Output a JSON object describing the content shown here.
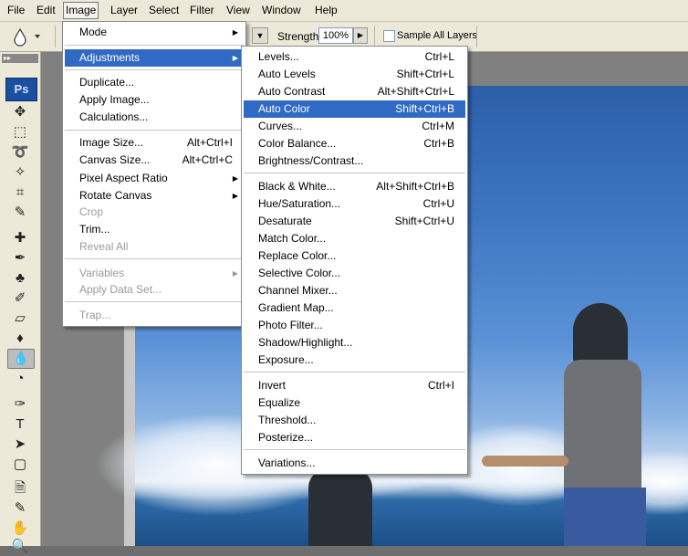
{
  "menubar": {
    "items": [
      "File",
      "Edit",
      "Image",
      "Layer",
      "Select",
      "Filter",
      "View",
      "Window",
      "Help"
    ],
    "active": "Image"
  },
  "options_bar": {
    "strength_label": "Strength:",
    "strength_value": "100%",
    "sample_all_layers_label": "Sample All Layers",
    "sample_all_layers_checked": false
  },
  "toolbox": {
    "logo": "Ps",
    "selected_tool": "blur-tool"
  },
  "image_menu": [
    {
      "label": "Mode",
      "submenu": true,
      "enabled": true
    },
    {
      "separator": true
    },
    {
      "label": "Adjustments",
      "submenu": true,
      "enabled": true,
      "highlighted": true
    },
    {
      "separator": true
    },
    {
      "label": "Duplicate...",
      "enabled": true
    },
    {
      "label": "Apply Image...",
      "enabled": true
    },
    {
      "label": "Calculations...",
      "enabled": true
    },
    {
      "separator": true
    },
    {
      "label": "Image Size...",
      "shortcut": "Alt+Ctrl+I",
      "enabled": true
    },
    {
      "label": "Canvas Size...",
      "shortcut": "Alt+Ctrl+C",
      "enabled": true
    },
    {
      "label": "Pixel Aspect Ratio",
      "submenu": true,
      "enabled": true
    },
    {
      "label": "Rotate Canvas",
      "submenu": true,
      "enabled": true
    },
    {
      "label": "Crop",
      "enabled": false
    },
    {
      "label": "Trim...",
      "enabled": true
    },
    {
      "label": "Reveal All",
      "enabled": false
    },
    {
      "separator": true
    },
    {
      "label": "Variables",
      "submenu": true,
      "enabled": false
    },
    {
      "label": "Apply Data Set...",
      "enabled": false
    },
    {
      "separator": true
    },
    {
      "label": "Trap...",
      "enabled": false
    }
  ],
  "adjustments_menu": [
    {
      "label": "Levels...",
      "shortcut": "Ctrl+L"
    },
    {
      "label": "Auto Levels",
      "shortcut": "Shift+Ctrl+L"
    },
    {
      "label": "Auto Contrast",
      "shortcut": "Alt+Shift+Ctrl+L"
    },
    {
      "label": "Auto Color",
      "shortcut": "Shift+Ctrl+B",
      "highlighted": true
    },
    {
      "label": "Curves...",
      "shortcut": "Ctrl+M"
    },
    {
      "label": "Color Balance...",
      "shortcut": "Ctrl+B"
    },
    {
      "label": "Brightness/Contrast..."
    },
    {
      "separator": true
    },
    {
      "label": "Black & White...",
      "shortcut": "Alt+Shift+Ctrl+B"
    },
    {
      "label": "Hue/Saturation...",
      "shortcut": "Ctrl+U"
    },
    {
      "label": "Desaturate",
      "shortcut": "Shift+Ctrl+U"
    },
    {
      "label": "Match Color..."
    },
    {
      "label": "Replace Color..."
    },
    {
      "label": "Selective Color..."
    },
    {
      "label": "Channel Mixer..."
    },
    {
      "label": "Gradient Map..."
    },
    {
      "label": "Photo Filter..."
    },
    {
      "label": "Shadow/Highlight..."
    },
    {
      "label": "Exposure..."
    },
    {
      "separator": true
    },
    {
      "label": "Invert",
      "shortcut": "Ctrl+I"
    },
    {
      "label": "Equalize"
    },
    {
      "label": "Threshold..."
    },
    {
      "label": "Posterize..."
    },
    {
      "separator": true
    },
    {
      "label": "Variations..."
    }
  ]
}
